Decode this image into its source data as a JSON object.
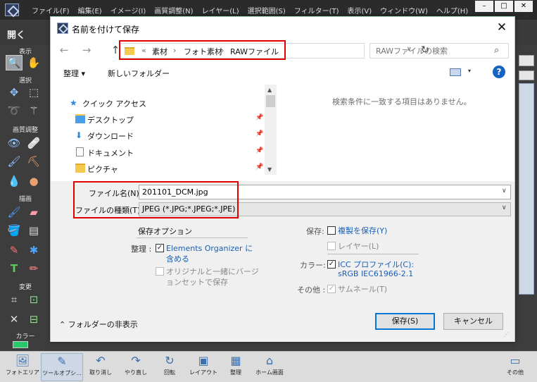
{
  "app": {
    "menu": [
      "ファイル(F)",
      "編集(E)",
      "イメージ(I)",
      "画質調整(N)",
      "レイヤー(L)",
      "選択範囲(S)",
      "フィルター(T)",
      "表示(V)",
      "ウィンドウ(W)",
      "ヘルプ(H)"
    ],
    "window_controls": [
      "–",
      "□",
      "✕"
    ],
    "open_label": "開く",
    "sections": {
      "view": "表示",
      "select": "選択",
      "enhance": "画質調整",
      "draw": "描画",
      "modify": "変更",
      "color": "カラー"
    },
    "bottom_bar": [
      "フォトエリア",
      "ツールオプシ...",
      "取り消し",
      "やり直し",
      "回転",
      "レイアウト",
      "整理",
      "ホーム画面",
      "その他"
    ]
  },
  "dialog": {
    "title": "名前を付けて保存",
    "close": "✕",
    "nav": {
      "back": "←",
      "forward": "→",
      "up": "↑"
    },
    "breadcrumb": [
      "«",
      "素材",
      "フォト素材",
      "RAWファイル"
    ],
    "breadcrumb_sep": "›",
    "search_placeholder": "RAWファイルの検索",
    "organize_label": "整理 ▾",
    "new_folder_label": "新しいフォルダー",
    "help": "?",
    "nav_pane": [
      {
        "label": "クイック アクセス",
        "icon": "star-icon",
        "pinned": false
      },
      {
        "label": "デスクトップ",
        "icon": "folder-icon",
        "pinned": true
      },
      {
        "label": "ダウンロード",
        "icon": "download-icon",
        "pinned": true
      },
      {
        "label": "ドキュメント",
        "icon": "document-icon",
        "pinned": true
      },
      {
        "label": "ピクチャ",
        "icon": "folder-icon",
        "pinned": true
      }
    ],
    "empty_message": "検索条件に一致する項目はありません。",
    "filename_label": "ファイル名(N):",
    "filename_value": "201101_DCM.jpg",
    "filetype_label": "ファイルの種類(T):",
    "filetype_value": "JPEG (*.JPG;*.JPEG;*.JPE)",
    "save_options_title": "保存オプション",
    "organize_row_label": "整理 :",
    "elements_organizer_line1": "Elements Organizer に",
    "elements_organizer_line2": "含める",
    "version_set_line1": "オリジナルと一緒にバージ",
    "version_set_line2": "ョンセットで保存",
    "save_label": "保存:",
    "save_copy": "複製を保存(Y)",
    "layers": "レイヤー(L)",
    "color_label": "カラー:",
    "icc_line1": "ICC プロファイル(C):",
    "icc_line2": "sRGB IEC61966-2.1",
    "other_label": "その他 :",
    "thumbnail": "サムネール(T)",
    "hide_folders": "フォルダーの非表示",
    "save_button": "保存(S)",
    "cancel_button": "キャンセル",
    "check": "✓",
    "caret": "∨"
  },
  "colors": {
    "accent": "#1a5fb4",
    "highlight_box": "#e00000",
    "dialog_border": "#9cd0b0"
  }
}
